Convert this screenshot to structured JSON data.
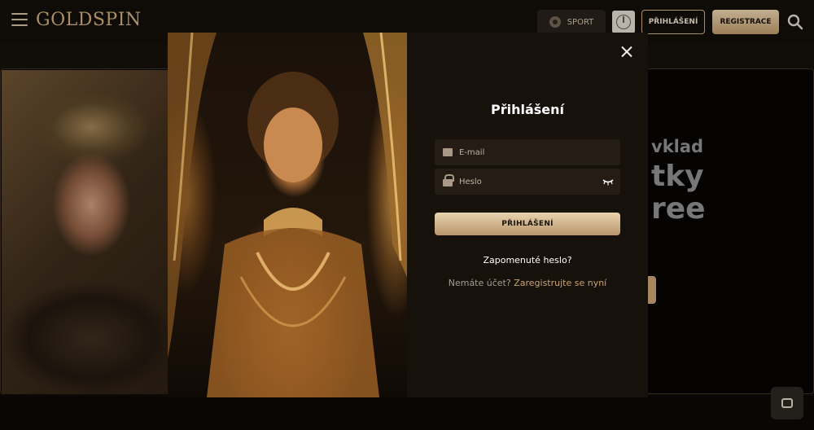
{
  "header": {
    "logo_text": "GOLDSPIN",
    "sport_label": "SPORT",
    "login_label": "PŘIHLÁŠENÍ",
    "register_label": "REGISTRACE"
  },
  "banner": {
    "line1": "vklad",
    "line2": "tky",
    "line3": "ree"
  },
  "modal": {
    "title": "Přihlášení",
    "email_placeholder": "E-mail",
    "password_placeholder": "Heslo",
    "submit_label": "PŘIHLÁŠENÍ",
    "forgot_label": "Zapomenuté heslo?",
    "no_account_text": "Nemáte účet?",
    "register_link": "Zaregistrujte se nyní"
  },
  "colors": {
    "accent_gold": "#c8a878",
    "background": "#0f0b08",
    "modal_bg": "#17110b"
  }
}
